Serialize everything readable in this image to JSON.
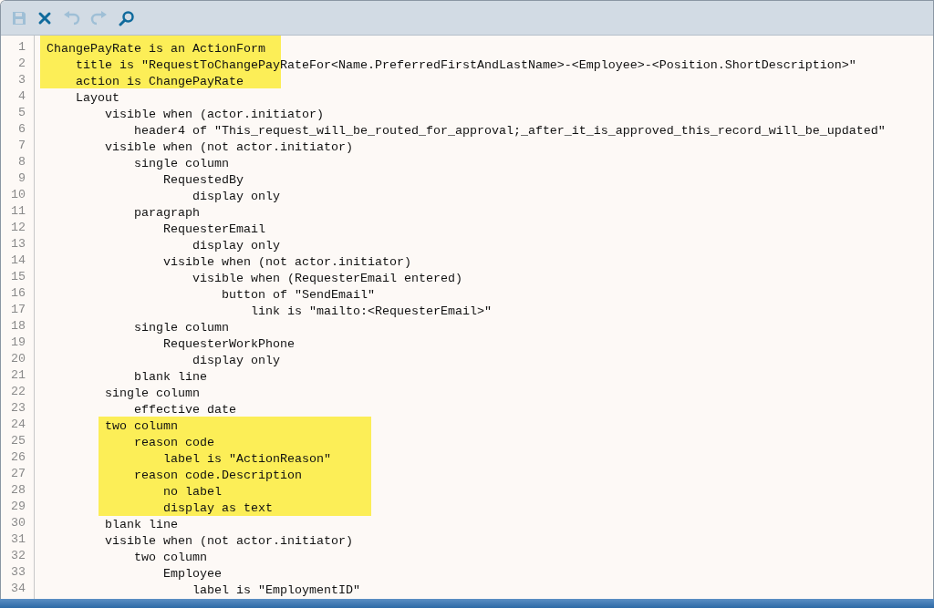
{
  "toolbar": [
    {
      "kind": "save",
      "disabled": true
    },
    {
      "kind": "close",
      "disabled": false
    },
    {
      "kind": "undo",
      "disabled": true
    },
    {
      "kind": "redo",
      "disabled": true
    },
    {
      "kind": "search",
      "disabled": false
    }
  ],
  "editor": {
    "lines": [
      {
        "number": "1",
        "text": "ChangePayRate is an ActionForm",
        "highlighted": true
      },
      {
        "number": "2",
        "text": "    title is \"RequestToChangePayRateFor<Name.PreferredFirstAndLastName>-<Employee>-<Position.ShortDescription>\"",
        "highlighted": true
      },
      {
        "number": "3",
        "text": "    action is ChangePayRate",
        "highlighted": true
      },
      {
        "number": "4",
        "text": "    Layout",
        "highlighted": false
      },
      {
        "number": "5",
        "text": "        visible when (actor.initiator)",
        "highlighted": false
      },
      {
        "number": "6",
        "text": "            header4 of \"This_request_will_be_routed_for_approval;_after_it_is_approved_this_record_will_be_updated\"",
        "highlighted": false
      },
      {
        "number": "7",
        "text": "        visible when (not actor.initiator)",
        "highlighted": false
      },
      {
        "number": "8",
        "text": "            single column",
        "highlighted": false
      },
      {
        "number": "9",
        "text": "                RequestedBy",
        "highlighted": false
      },
      {
        "number": "10",
        "text": "                    display only",
        "highlighted": false
      },
      {
        "number": "11",
        "text": "            paragraph",
        "highlighted": false
      },
      {
        "number": "12",
        "text": "                RequesterEmail",
        "highlighted": false
      },
      {
        "number": "13",
        "text": "                    display only",
        "highlighted": false
      },
      {
        "number": "14",
        "text": "                visible when (not actor.initiator)",
        "highlighted": false
      },
      {
        "number": "15",
        "text": "                    visible when (RequesterEmail entered)",
        "highlighted": false
      },
      {
        "number": "16",
        "text": "                        button of \"SendEmail\"",
        "highlighted": false
      },
      {
        "number": "17",
        "text": "                            link is \"mailto:<RequesterEmail>\"",
        "highlighted": false
      },
      {
        "number": "18",
        "text": "            single column",
        "highlighted": false
      },
      {
        "number": "19",
        "text": "                RequesterWorkPhone",
        "highlighted": false
      },
      {
        "number": "20",
        "text": "                    display only",
        "highlighted": false
      },
      {
        "number": "21",
        "text": "            blank line",
        "highlighted": false
      },
      {
        "number": "22",
        "text": "        single column",
        "highlighted": false
      },
      {
        "number": "23",
        "text": "            effective date",
        "highlighted": false
      },
      {
        "number": "24",
        "text": "        two column",
        "highlighted": true
      },
      {
        "number": "25",
        "text": "            reason code",
        "highlighted": true
      },
      {
        "number": "26",
        "text": "                label is \"ActionReason\"",
        "highlighted": true
      },
      {
        "number": "27",
        "text": "            reason code.Description",
        "highlighted": true
      },
      {
        "number": "28",
        "text": "                no label",
        "highlighted": true
      },
      {
        "number": "29",
        "text": "                display as text",
        "highlighted": true
      },
      {
        "number": "30",
        "text": "        blank line",
        "highlighted": false
      },
      {
        "number": "31",
        "text": "        visible when (not actor.initiator)",
        "highlighted": false
      },
      {
        "number": "32",
        "text": "            two column",
        "highlighted": false
      },
      {
        "number": "33",
        "text": "                Employee",
        "highlighted": false
      },
      {
        "number": "34",
        "text": "                    label is \"EmploymentID\"",
        "highlighted": false
      }
    ]
  }
}
